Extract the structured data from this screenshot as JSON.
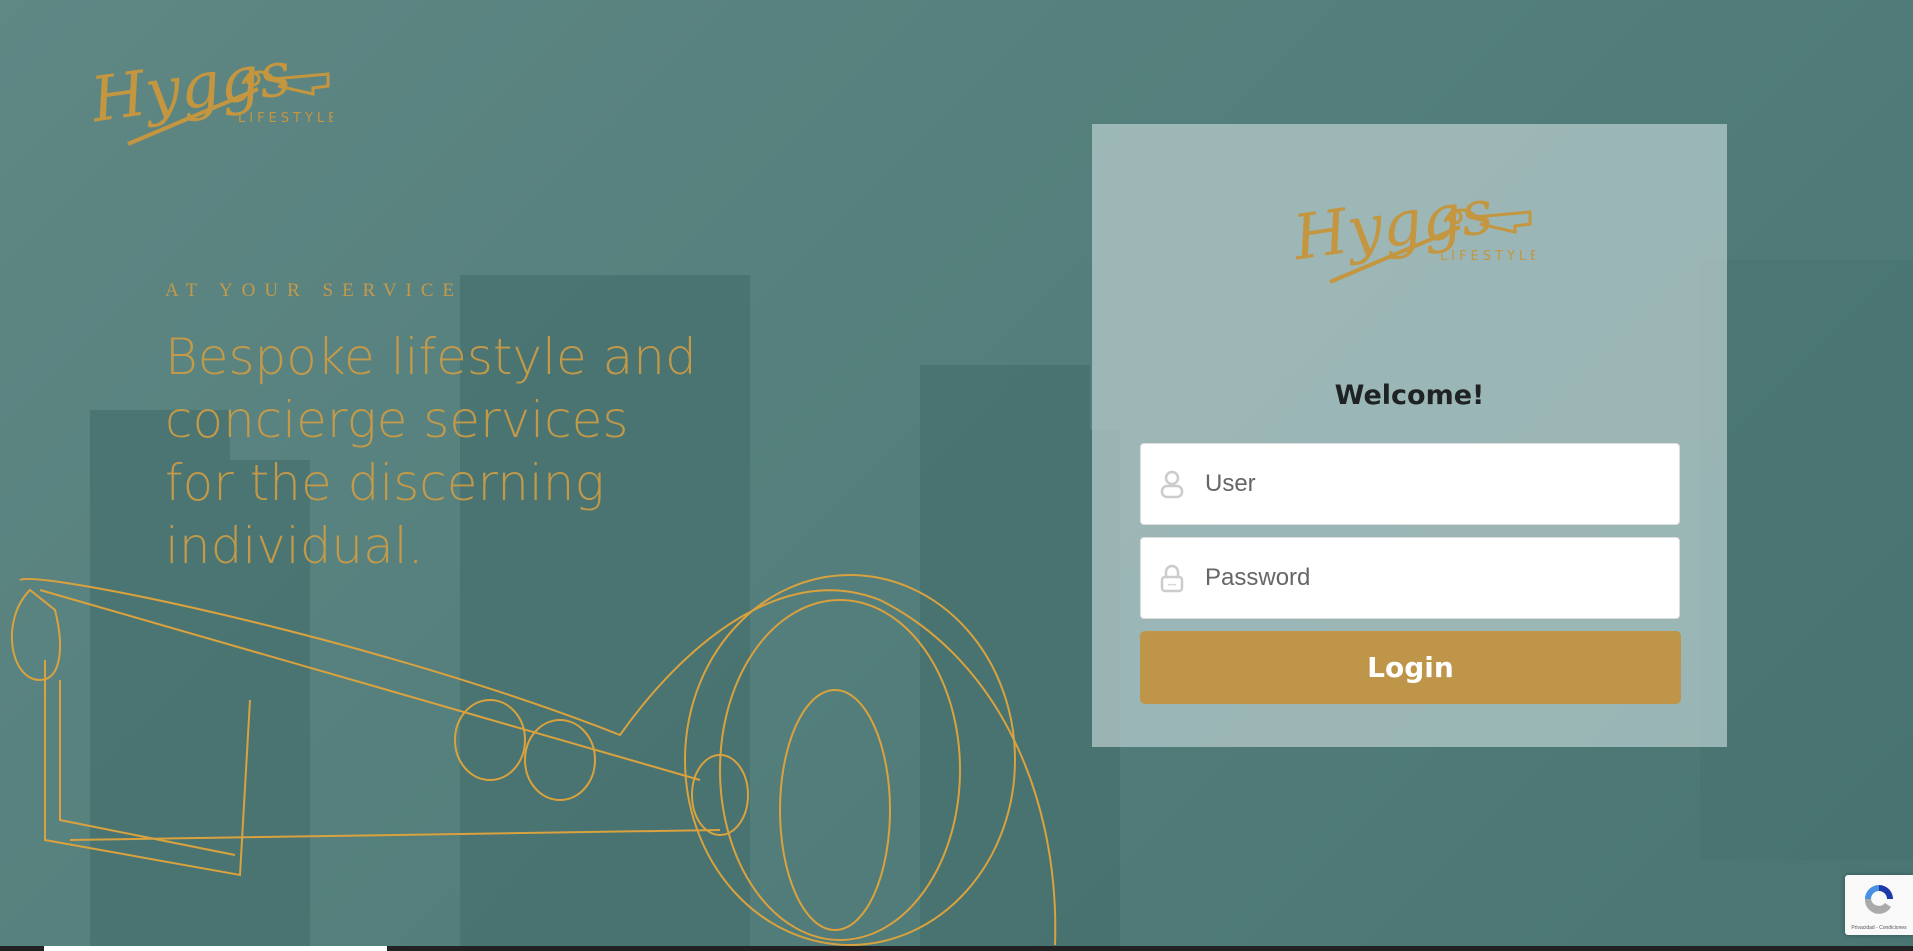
{
  "brand": {
    "name": "Hyggs",
    "sub": "LIFESTYLE"
  },
  "hero": {
    "kicker": "AT YOUR SERVICE",
    "headline_lines": [
      "Bespoke lifestyle and",
      "concierge services",
      "for the discerning",
      "individual."
    ]
  },
  "login": {
    "title": "Welcome!",
    "user_placeholder": "User",
    "password_placeholder": "Password",
    "button": "Login"
  },
  "recaptcha": {
    "footer": "Privacidad - Condiciones"
  },
  "colors": {
    "gold": "#bf9649",
    "teal": "#4e7775"
  }
}
